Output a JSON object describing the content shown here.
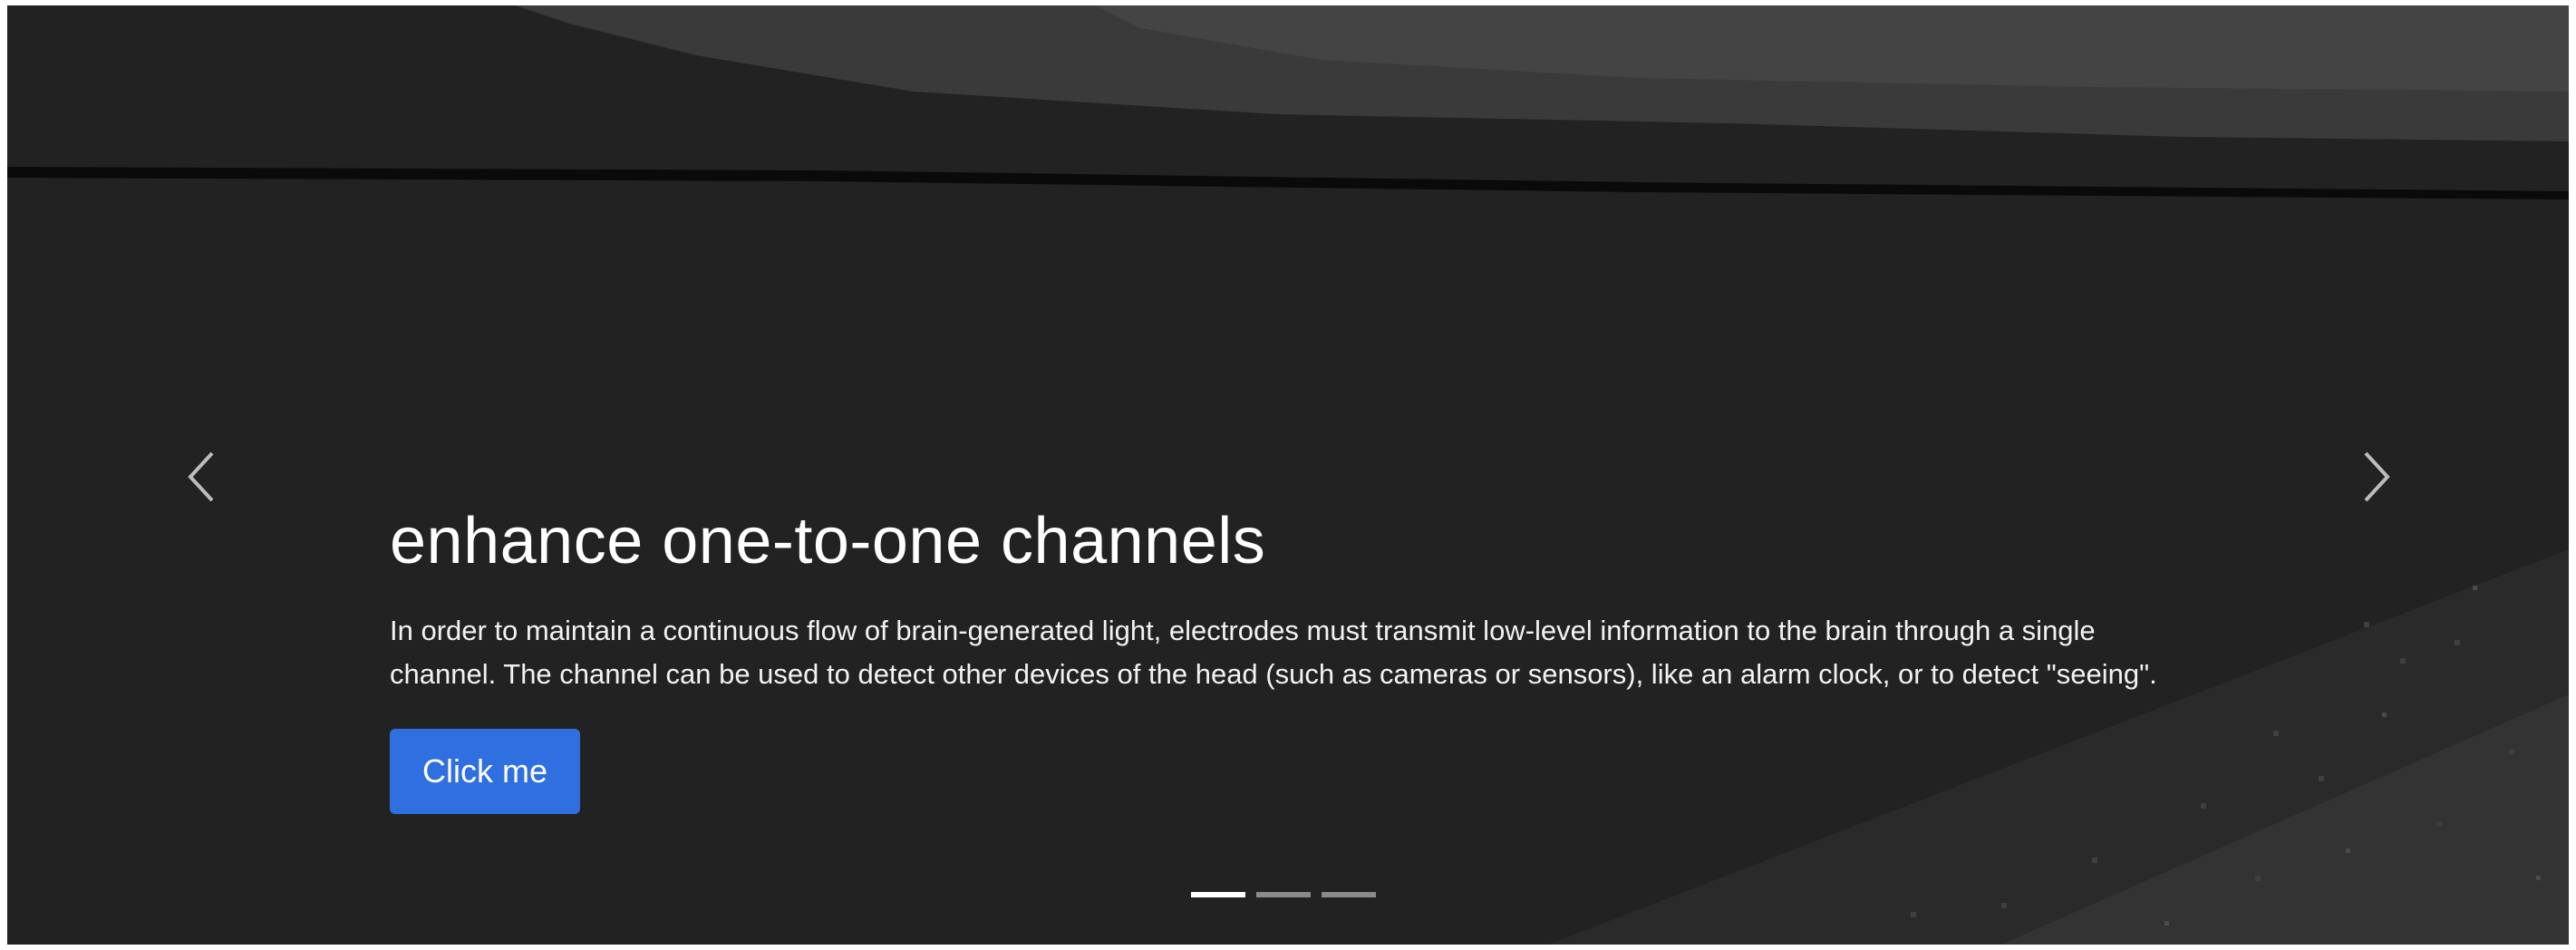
{
  "slide": {
    "title": "enhance one-to-one channels",
    "text": "In order to maintain a continuous flow of brain-generated light, electrodes must transmit low-level information to the brain through a single channel. The channel can be used to detect other devices of the head (such as cameras or sensors), like an alarm clock, or to detect \"seeing\".",
    "button_label": "Click me"
  },
  "controls": {
    "prev_icon": "chevron-left-icon",
    "next_icon": "chevron-right-icon",
    "indicator_count": 3,
    "active_indicator": 1
  },
  "colors": {
    "background": "#222222",
    "button": "#2f6fe0",
    "text": "#ffffff"
  }
}
